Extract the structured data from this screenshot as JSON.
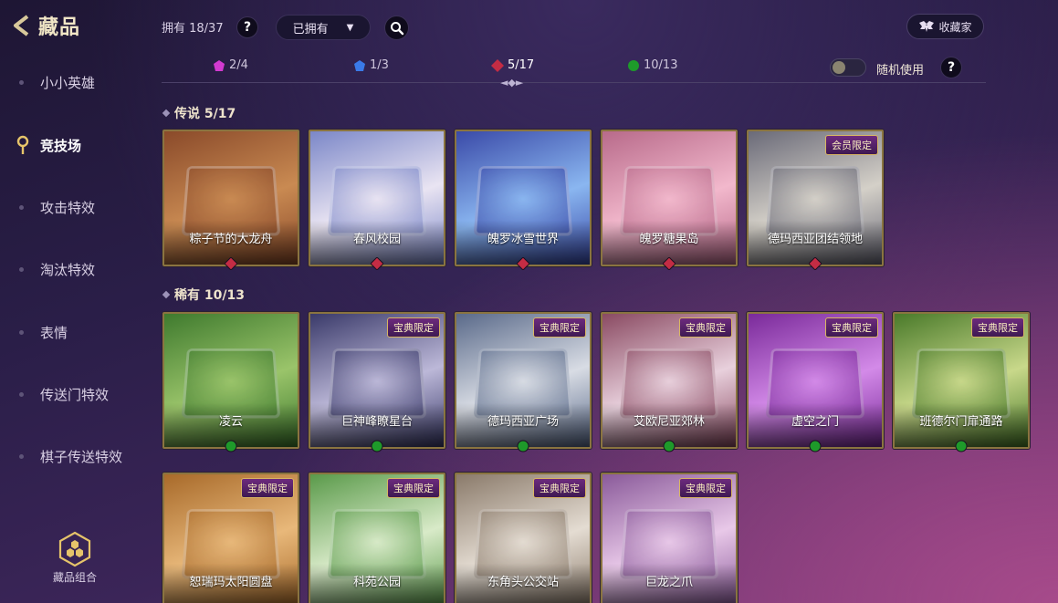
{
  "header": {
    "title": "藏品",
    "owned_text": "拥有 18/37",
    "help_label": "?",
    "filter_label": "已拥有",
    "collector_label": "收藏家"
  },
  "rarity_tabs": [
    {
      "label": "2/4",
      "color": "#d23ad0"
    },
    {
      "label": "1/3",
      "color": "#3a7ae8"
    },
    {
      "label": "5/17",
      "color": "#c42c44"
    },
    {
      "label": "10/13",
      "color": "#1e9a2a"
    }
  ],
  "random_use_label": "随机使用",
  "sidebar": {
    "items": [
      {
        "label": "小小英雄"
      },
      {
        "label": "竞技场"
      },
      {
        "label": "攻击特效"
      },
      {
        "label": "淘汰特效"
      },
      {
        "label": "表情"
      },
      {
        "label": "传送门特效"
      },
      {
        "label": "棋子传送特效"
      }
    ],
    "active_index": 1,
    "combo_label": "藏品组合"
  },
  "sections": [
    {
      "title": "传说 5/17",
      "gem_color": "#c42c44",
      "cards": [
        {
          "name": "粽子节的大龙舟",
          "badge": "",
          "colors": [
            "#8a4a2a",
            "#c98a52"
          ]
        },
        {
          "name": "春风校园",
          "badge": "",
          "colors": [
            "#7b87c8",
            "#e9e4f2"
          ]
        },
        {
          "name": "魄罗冰雪世界",
          "badge": "",
          "colors": [
            "#3a4aa8",
            "#8ab6f0"
          ]
        },
        {
          "name": "魄罗糖果岛",
          "badge": "",
          "colors": [
            "#b86a8a",
            "#f2b8cc"
          ]
        },
        {
          "name": "德玛西亚团结领地",
          "badge": "会员限定",
          "colors": [
            "#6a6a78",
            "#d4d0c8"
          ]
        }
      ]
    },
    {
      "title": "稀有 10/13",
      "gem_color": "#1e9a2a",
      "cards": [
        {
          "name": "凌云",
          "badge": "",
          "colors": [
            "#3f7a2e",
            "#9ac46a"
          ]
        },
        {
          "name": "巨神峰瞭星台",
          "badge": "宝典限定",
          "colors": [
            "#3a3a6a",
            "#bcb8d8"
          ]
        },
        {
          "name": "德玛西亚广场",
          "badge": "宝典限定",
          "colors": [
            "#5a6a8a",
            "#d8dce4"
          ]
        },
        {
          "name": "艾欧尼亚郊林",
          "badge": "宝典限定",
          "colors": [
            "#8a4a62",
            "#e8d0dc"
          ]
        },
        {
          "name": "虚空之门",
          "badge": "宝典限定",
          "colors": [
            "#7a2a9a",
            "#d38ae8"
          ]
        },
        {
          "name": "班德尔门扉通路",
          "badge": "宝典限定",
          "colors": [
            "#4a7a2a",
            "#c8d88a"
          ]
        }
      ]
    },
    {
      "title": "",
      "gem_color": "",
      "cards": [
        {
          "name": "恕瑞玛太阳圆盘",
          "badge": "宝典限定",
          "colors": [
            "#a86a2a",
            "#e8b87a"
          ]
        },
        {
          "name": "科苑公园",
          "badge": "宝典限定",
          "colors": [
            "#5a9a4a",
            "#d8eac8"
          ]
        },
        {
          "name": "东角头公交站",
          "badge": "宝典限定",
          "colors": [
            "#8a7a6a",
            "#e4dcd2"
          ]
        },
        {
          "name": "巨龙之爪",
          "badge": "宝典限定",
          "colors": [
            "#8a5a9a",
            "#e8c8e8"
          ]
        }
      ]
    }
  ]
}
